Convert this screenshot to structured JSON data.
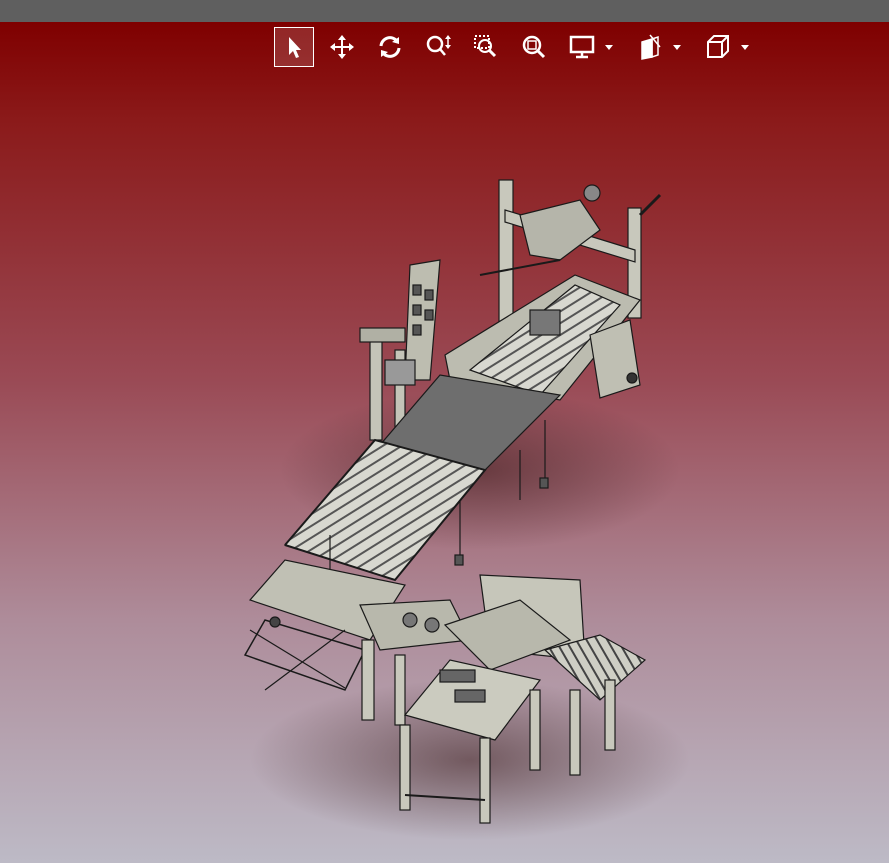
{
  "colors": {
    "title_bar": "#5f5f5f",
    "background_top": "#7f0000",
    "background_bottom": "#bdbac6",
    "icon": "#ffffff",
    "model_fill": "#bfbfb4",
    "model_dark": "#6b6b6b",
    "model_line": "#1a1a1a"
  },
  "toolbar": {
    "tools": [
      {
        "name": "select",
        "icon": "pointer-arrow-icon",
        "active": true
      },
      {
        "name": "pan",
        "icon": "move-arrows-icon",
        "active": false
      },
      {
        "name": "rotate",
        "icon": "rotate-icon",
        "active": false
      },
      {
        "name": "zoom",
        "icon": "zoom-icon",
        "active": false
      },
      {
        "name": "zoom-window",
        "icon": "zoom-window-icon",
        "active": false
      },
      {
        "name": "zoom-fit",
        "icon": "zoom-fit-icon",
        "active": false
      },
      {
        "name": "display-mode",
        "icon": "monitor-icon",
        "active": false,
        "dropdown": true
      },
      {
        "name": "section",
        "icon": "section-view-icon",
        "active": false,
        "dropdown": true
      },
      {
        "name": "standard-views",
        "icon": "cube-view-icon",
        "active": false,
        "dropdown": true
      }
    ]
  },
  "scene": {
    "model": "conveyor-assembly-3d-model"
  }
}
